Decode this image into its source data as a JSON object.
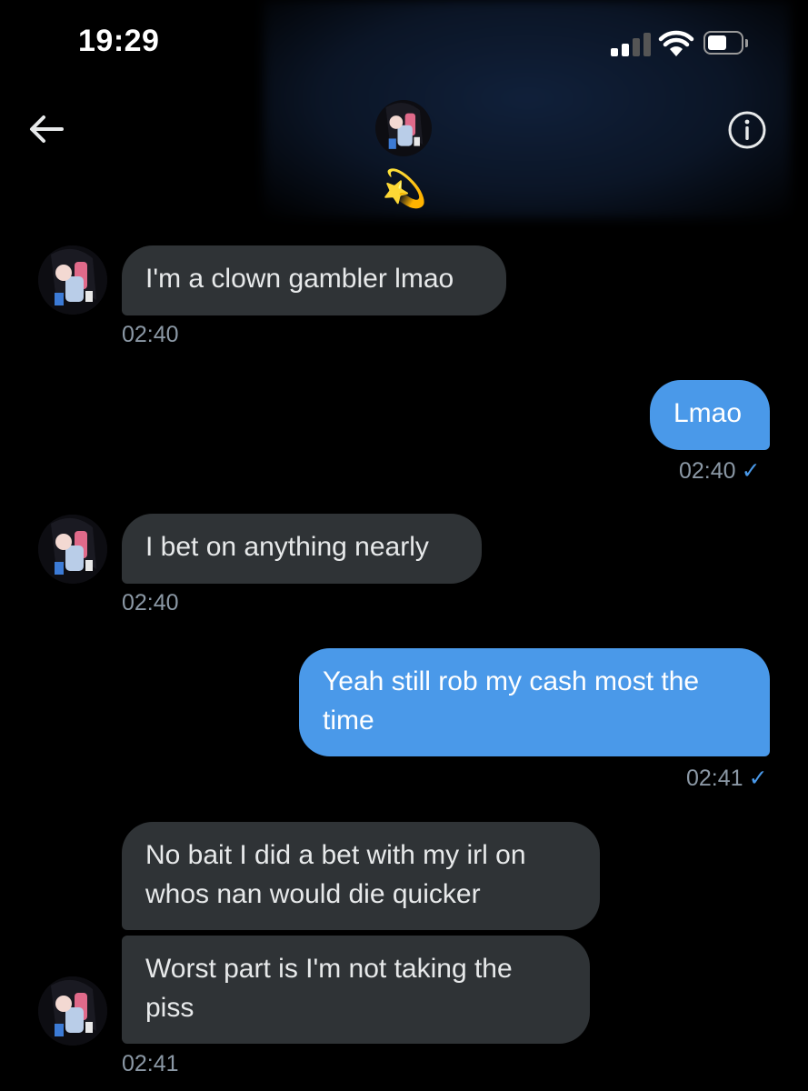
{
  "status_bar": {
    "time": "19:29"
  },
  "header": {
    "back_icon": "arrow-left-icon",
    "info_icon": "info-circle-icon",
    "conversation_emoji": "💫"
  },
  "colors": {
    "background": "#000000",
    "incoming_bubble": "#2f3336",
    "outgoing_bubble": "#4a99e9",
    "timestamp": "#8b98a5"
  },
  "messages": [
    {
      "direction": "incoming",
      "text": "I'm a clown gambler lmao",
      "time": "02:40"
    },
    {
      "direction": "outgoing",
      "text": "Lmao",
      "time": "02:40",
      "status": "✓"
    },
    {
      "direction": "incoming",
      "text": "I bet on anything nearly",
      "time": "02:40"
    },
    {
      "direction": "outgoing",
      "text": "Yeah still rob my cash most the time",
      "time": "02:41",
      "status": "✓"
    },
    {
      "direction": "incoming",
      "text": "No bait I did a bet with my irl on whos nan would die quicker"
    },
    {
      "direction": "incoming",
      "text": "Worst part is I'm not taking the piss",
      "time": "02:41"
    }
  ]
}
